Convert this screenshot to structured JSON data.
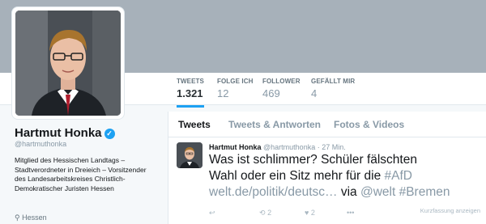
{
  "profile": {
    "name": "Hartmut Honka",
    "handle": "@hartmuthonka",
    "bio": "Mitglied des Hessischen Landtags – Stadtverordneter in Dreieich – Vorsitzender des Landesarbeitskreises Christlich-Demokratischer Juristen Hessen",
    "location": "Hessen"
  },
  "stats": [
    {
      "label": "TWEETS",
      "value": "1.321"
    },
    {
      "label": "FOLGE ICH",
      "value": "12"
    },
    {
      "label": "FOLLOWER",
      "value": "469"
    },
    {
      "label": "GEFÄLLT MIR",
      "value": "4"
    }
  ],
  "tabs": [
    "Tweets",
    "Tweets & Antworten",
    "Fotos & Videos"
  ],
  "tweet": {
    "author": "Hartmut Honka",
    "handle": "@hartmuthonka",
    "time": "· 27 Min.",
    "line1": "Was ist schlimmer? Schüler fälschten",
    "line2_text": "Wahl oder ein Sitz mehr für die ",
    "line2_tag": "#AfD",
    "link": "welt.de/politik/deutsc…",
    "via": " via ",
    "mention": "@welt",
    "tag2": " #Bremen",
    "retweets": "2",
    "likes": "2",
    "summary": "Kurzfassung anzeigen"
  },
  "colors": {
    "accent": "#1da1f2",
    "header": "#a7b1ba",
    "muted": "#8899a6"
  },
  "icons": [
    "verified-badge-icon",
    "location-pin-icon",
    "reply-icon",
    "retweet-icon",
    "like-icon",
    "more-icon"
  ]
}
